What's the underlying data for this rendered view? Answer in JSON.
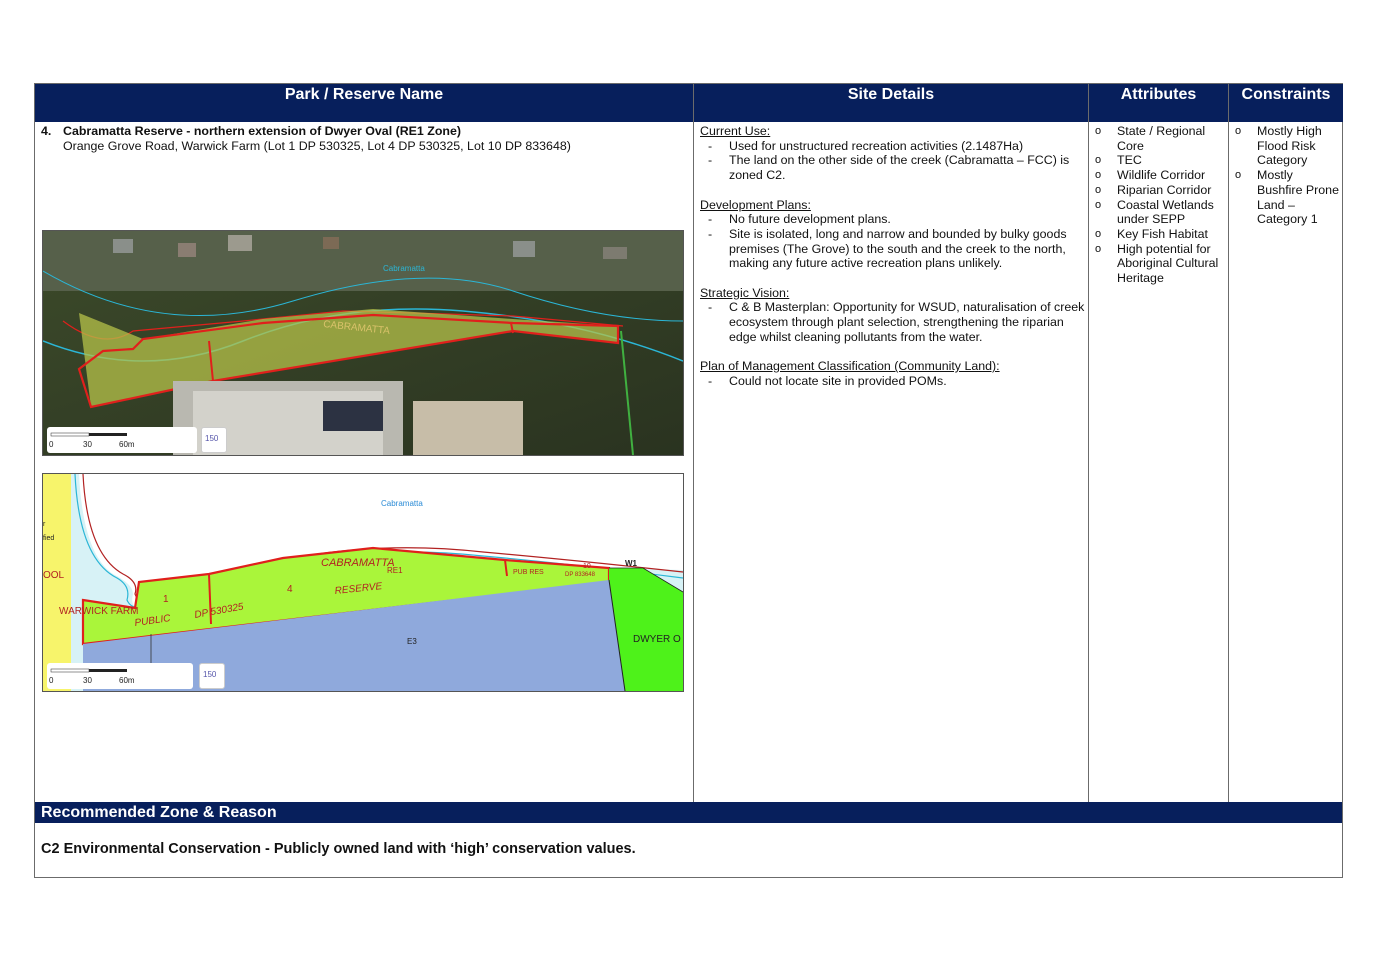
{
  "headers": {
    "park": "Park / Reserve Name",
    "site": "Site Details",
    "attributes": "Attributes",
    "constraints": "Constraints"
  },
  "park": {
    "number": "4.",
    "title": "Cabramatta Reserve - northern extension of Dwyer Oval (RE1 Zone)",
    "address": "Orange Grove Road, Warwick Farm (Lot 1 DP 530325, Lot 4 DP 530325, Lot 10 DP 833648)"
  },
  "site_details": [
    {
      "heading": "Current Use:",
      "items": [
        "Used for unstructured recreation activities (2.1487Ha)",
        "The land on the other side of the creek (Cabramatta – FCC) is zoned C2."
      ]
    },
    {
      "heading": "Development Plans:",
      "items": [
        "No future development plans.",
        "Site is isolated, long and narrow and bounded by bulky goods premises (The Grove) to the south and the creek to the north, making any future active recreation plans unlikely."
      ]
    },
    {
      "heading": "Strategic Vision:",
      "items": [
        "C & B Masterplan: Opportunity for WSUD, naturalisation of creek ecosystem through plant selection, strengthening the riparian edge whilst cleaning pollutants from the water."
      ]
    },
    {
      "heading": "Plan of Management Classification (Community Land):",
      "items": [
        "Could not locate site in provided POMs."
      ]
    }
  ],
  "attributes": [
    "State / Regional Core",
    "TEC",
    "Wildlife Corridor",
    "Riparian Corridor",
    "Coastal Wetlands under SEPP",
    "Key Fish Habitat",
    "High potential for Aboriginal Cultural Heritage"
  ],
  "constraints": [
    "Mostly High Flood Risk Category",
    "Mostly Bushfire Prone Land – Category 1"
  ],
  "aerial_map": {
    "creek_label": "Cabramatta",
    "parcel_label": "CABRAMATTA",
    "scale": {
      "zero": "0",
      "mid": "30",
      "end": "60m",
      "button": "150"
    }
  },
  "zoning_map": {
    "creek_label": "Cabramatta",
    "labels": {
      "cabramatta": "CABRAMATTA",
      "re1": "RE1",
      "reserve": "RESERVE",
      "public": "PUBLIC",
      "dp": "DP 530325",
      "lot1": "1",
      "lot4": "4",
      "pub_res": "PUB RES",
      "lot10": "10",
      "dp2": "DP 833648",
      "w1": "W1",
      "e3": "E3",
      "warwick": "WARWICK FARM",
      "dwyer": "DWYER O",
      "ool": "OOL",
      "fied": "fied",
      "r": "r"
    },
    "scale": {
      "zero": "0",
      "mid": "30",
      "end": "60m",
      "button": "150"
    }
  },
  "recommended": {
    "heading": "Recommended Zone & Reason",
    "text": "C2 Environmental Conservation - Publicly owned land with ‘high’ conservation values."
  },
  "colors": {
    "header_navy": "#071f5c",
    "parcel_red": "#e0201c",
    "zone_re1": "#aaf53a",
    "zone_e3": "#8fa9dc",
    "zone_green": "#4ef21a",
    "creek_blue": "#2bb6d6"
  }
}
